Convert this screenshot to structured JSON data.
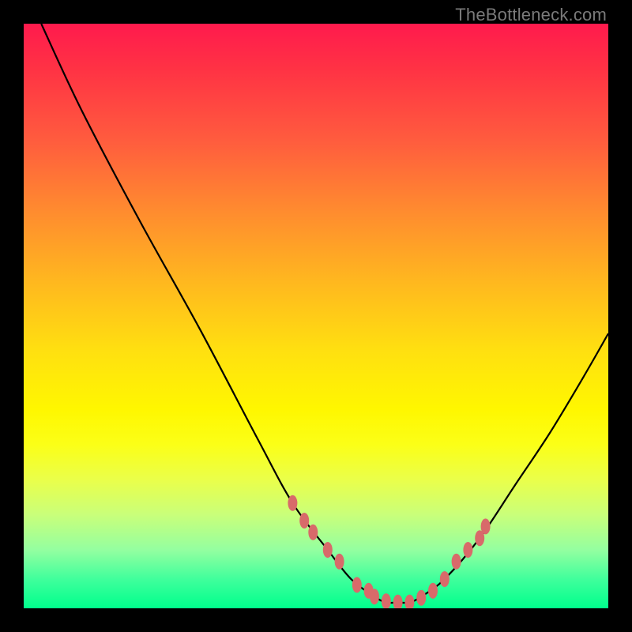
{
  "watermark": "TheBottleneck.com",
  "chart_data": {
    "type": "line",
    "title": "",
    "xlabel": "",
    "ylabel": "",
    "xlim": [
      0,
      100
    ],
    "ylim": [
      0,
      100
    ],
    "x": [
      3,
      10,
      20,
      30,
      40,
      46,
      52,
      56,
      60,
      62,
      64,
      66,
      68,
      72,
      78,
      84,
      90,
      96,
      100
    ],
    "y": [
      100,
      85,
      66,
      48,
      29,
      18,
      10,
      5,
      2,
      1,
      1,
      1,
      2,
      5,
      12,
      21,
      30,
      40,
      47
    ],
    "annotations": {
      "dots_color": "#d86a6a",
      "dots_x": [
        46,
        48,
        49.5,
        52,
        54,
        57,
        59,
        60,
        62,
        64,
        66,
        68,
        70,
        72,
        74,
        76,
        78,
        79
      ],
      "dots_y": [
        18,
        15,
        13,
        10,
        8,
        4,
        3,
        2,
        1.2,
        1,
        1,
        1.8,
        3,
        5,
        8,
        10,
        12,
        14
      ]
    },
    "gradient_stops": [
      {
        "pos": 0,
        "color": "#ff1a4d"
      },
      {
        "pos": 50,
        "color": "#ffd400"
      },
      {
        "pos": 100,
        "color": "#00ff8c"
      }
    ]
  }
}
